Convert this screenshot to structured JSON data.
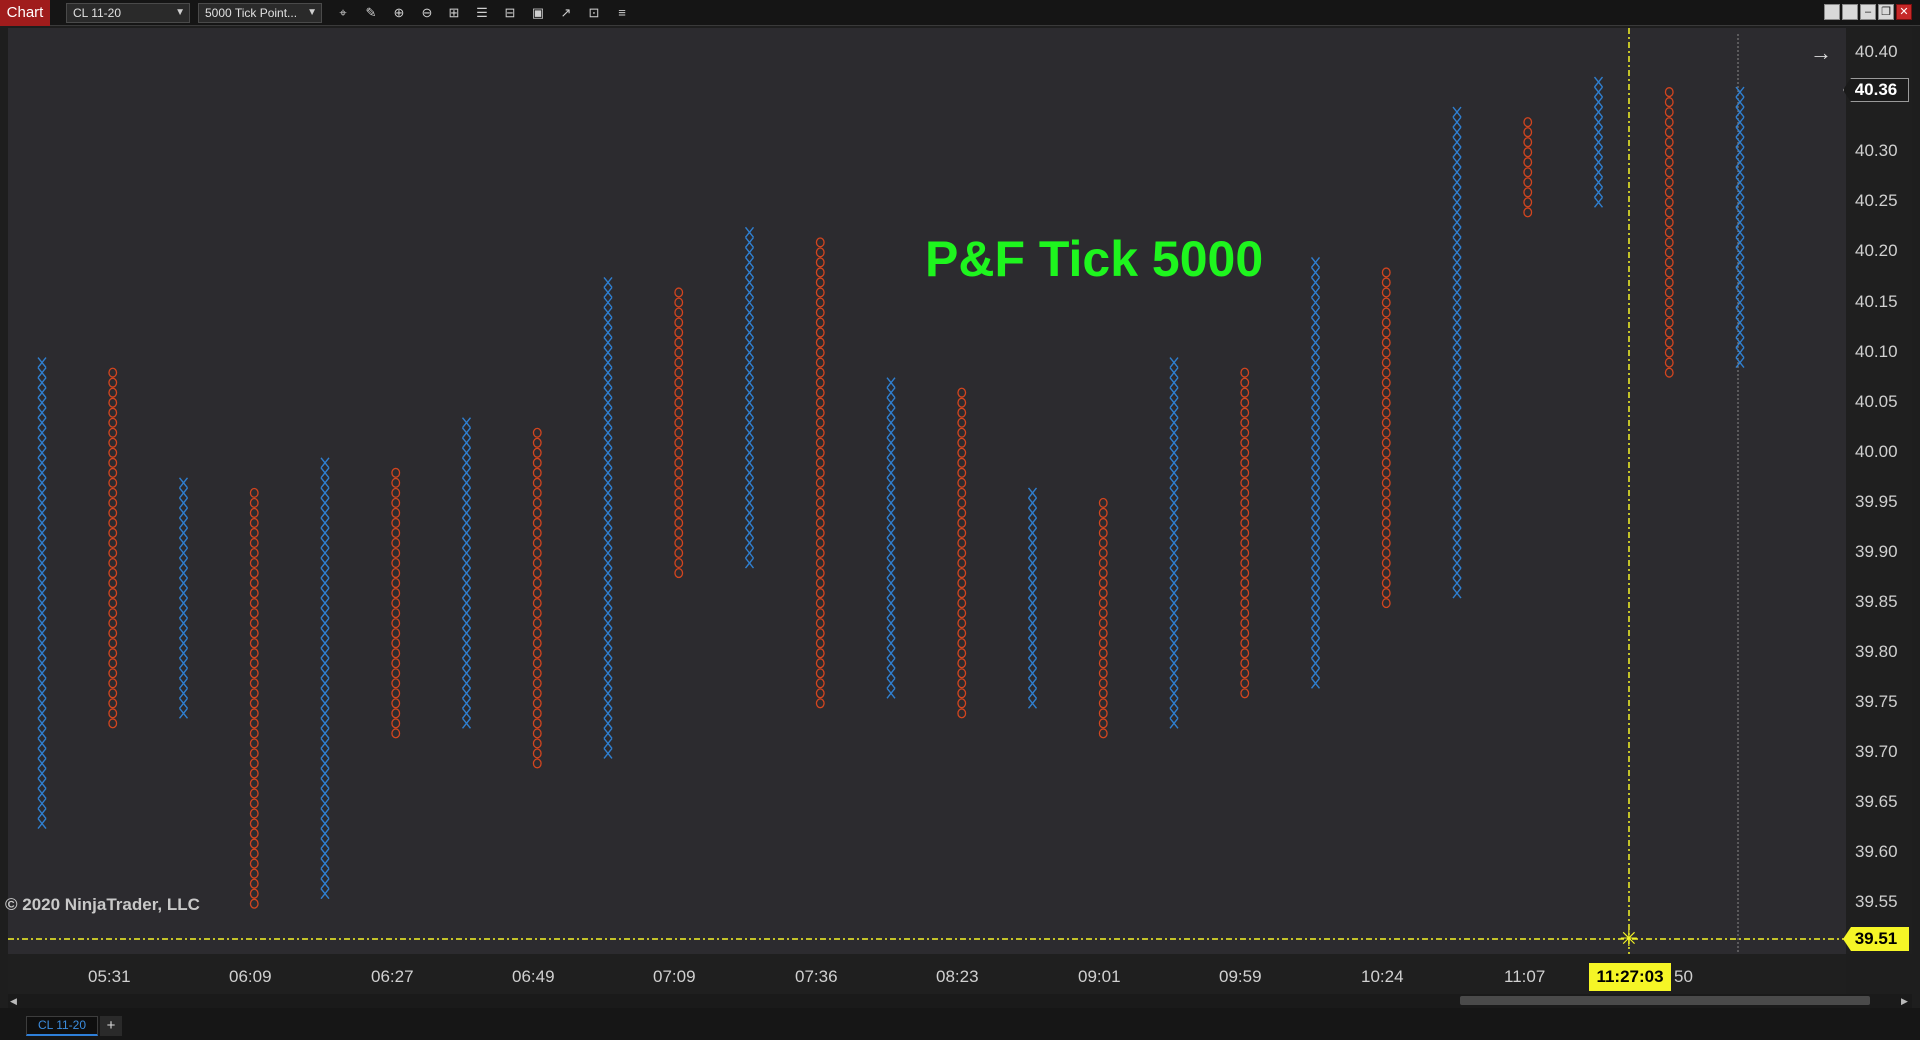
{
  "titlebar": {
    "chart_tab": "Chart",
    "instrument_select": "CL 11-20",
    "period_select": "5000 Tick Point...",
    "toolbar_icons": [
      "crosshair-icon",
      "pencil-icon",
      "zoom-in-icon",
      "zoom-out-icon",
      "grid-icon",
      "properties-icon",
      "template-icon",
      "data-box-icon",
      "strategy-icon",
      "indicator-icon",
      "list-icon"
    ],
    "window_buttons": [
      "tile-icon",
      "maximize-icon",
      "minimize-icon",
      "restore-icon",
      "close-icon"
    ]
  },
  "overlay_title": "P&F Tick 5000",
  "copyright": "© 2020 NinjaTrader, LLC",
  "price_axis": {
    "labels": [
      "40.40",
      "40.30",
      "40.25",
      "40.20",
      "40.15",
      "40.10",
      "40.05",
      "40.00",
      "39.95",
      "39.90",
      "39.85",
      "39.80",
      "39.75",
      "39.70",
      "39.65",
      "39.60",
      "39.55"
    ],
    "last_price": "40.36",
    "cursor_price": "39.51"
  },
  "time_axis": {
    "labels": [
      "05:31",
      "06:09",
      "06:27",
      "06:49",
      "07:09",
      "07:36",
      "08:23",
      "09:01",
      "09:59",
      "10:24",
      "11:07",
      "50"
    ],
    "cursor_time": "11:27:03"
  },
  "bottom": {
    "instrument_tab": "CL 11-20",
    "add_tab": "+"
  },
  "colors": {
    "x_column": "#2f7fd0",
    "o_column": "#d2451f",
    "title": "#1ef51e",
    "cursor": "#f5f526",
    "background": "#2c2b2f"
  },
  "chart_data": {
    "type": "point-and-figure",
    "title": "P&F Tick 5000",
    "box_size": 0.01,
    "y_range": [
      39.5,
      40.42
    ],
    "columns": [
      {
        "type": "X",
        "low": 39.63,
        "high": 40.09
      },
      {
        "type": "O",
        "low": 39.73,
        "high": 40.08
      },
      {
        "type": "X",
        "low": 39.74,
        "high": 39.97
      },
      {
        "type": "O",
        "low": 39.55,
        "high": 39.96
      },
      {
        "type": "X",
        "low": 39.56,
        "high": 39.99
      },
      {
        "type": "O",
        "low": 39.72,
        "high": 39.98
      },
      {
        "type": "X",
        "low": 39.73,
        "high": 40.03
      },
      {
        "type": "O",
        "low": 39.69,
        "high": 40.02
      },
      {
        "type": "X",
        "low": 39.7,
        "high": 40.17
      },
      {
        "type": "O",
        "low": 39.88,
        "high": 40.16
      },
      {
        "type": "X",
        "low": 39.89,
        "high": 40.22
      },
      {
        "type": "O",
        "low": 39.75,
        "high": 40.21
      },
      {
        "type": "X",
        "low": 39.76,
        "high": 40.07
      },
      {
        "type": "O",
        "low": 39.74,
        "high": 40.06
      },
      {
        "type": "X",
        "low": 39.75,
        "high": 39.96
      },
      {
        "type": "O",
        "low": 39.72,
        "high": 39.95
      },
      {
        "type": "X",
        "low": 39.73,
        "high": 40.09
      },
      {
        "type": "O",
        "low": 39.76,
        "high": 40.08
      },
      {
        "type": "X",
        "low": 39.77,
        "high": 40.19
      },
      {
        "type": "O",
        "low": 39.85,
        "high": 40.18
      },
      {
        "type": "X",
        "low": 39.86,
        "high": 40.34
      },
      {
        "type": "O",
        "low": 40.24,
        "high": 40.33
      },
      {
        "type": "X",
        "low": 40.25,
        "high": 40.37
      },
      {
        "type": "O",
        "low": 40.08,
        "high": 40.36
      },
      {
        "type": "X",
        "low": 40.09,
        "high": 40.36
      }
    ]
  }
}
